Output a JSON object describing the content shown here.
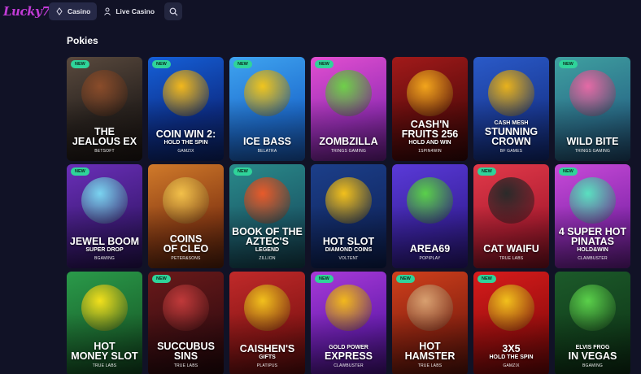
{
  "header": {
    "logo": "Lucky7",
    "nav": [
      {
        "label": "Casino",
        "active": true
      },
      {
        "label": "Live Casino",
        "active": false
      }
    ]
  },
  "section": {
    "title": "Pokies"
  },
  "badge_label": "NEW",
  "games": [
    {
      "title": "THE\nJEALOUS EX",
      "subtitle": "",
      "provider": "BETSOFT",
      "is_new": true
    },
    {
      "title": "COIN WIN 2:",
      "subtitle": "HOLD THE SPIN",
      "provider": "GAMZIX",
      "is_new": true
    },
    {
      "title": "ICE BASS",
      "subtitle": "",
      "provider": "BELATRA",
      "is_new": true
    },
    {
      "title": "ZOMBZILLA",
      "subtitle": "",
      "provider": "TRINGS GAMING",
      "is_new": true
    },
    {
      "title": "CASH'N\nFRUITS 256",
      "subtitle": "HOLD AND WIN",
      "provider": "1SPIN4WIN",
      "is_new": false
    },
    {
      "title": "STUNNING\nCROWN",
      "subtitle": "",
      "provider": "BF GAMES",
      "is_new": false,
      "kicker": "CASH MESH"
    },
    {
      "title": "WILD BITE",
      "subtitle": "",
      "provider": "TRINGS GAMING",
      "is_new": true
    },
    {
      "title": "JEWEL BOOM",
      "subtitle": "SUPER DROP",
      "provider": "BGAMING",
      "is_new": true
    },
    {
      "title": "COINS\nOF CLEO",
      "subtitle": "",
      "provider": "PETER&SONS",
      "is_new": false
    },
    {
      "title": "BOOK OF THE\nAZTEC'S",
      "subtitle": "LEGEND",
      "provider": "ZILLION",
      "is_new": true
    },
    {
      "title": "HOT SLOT",
      "subtitle": "DIAMOND COINS",
      "provider": "VOLTENT",
      "is_new": false
    },
    {
      "title": "AREA69",
      "subtitle": "",
      "provider": "POPIPLAY",
      "is_new": false
    },
    {
      "title": "CAT WAIFU",
      "subtitle": "",
      "provider": "TRUE LABS",
      "is_new": true
    },
    {
      "title": "4 SUPER HOT\nPINATAS",
      "subtitle": "HOLD&WIN",
      "provider": "CLAWBUSTER",
      "is_new": true
    },
    {
      "title": "HOT\nMONEY SLOT",
      "subtitle": "",
      "provider": "TRUE LABS",
      "is_new": false
    },
    {
      "title": "SUCCUBUS\nSINS",
      "subtitle": "",
      "provider": "TRUE LABS",
      "is_new": true
    },
    {
      "title": "CAISHEN'S",
      "subtitle": "GIFTS",
      "provider": "PLATIPUS",
      "is_new": false
    },
    {
      "title": "EXPRESS",
      "subtitle": "",
      "provider": "CLAWBUSTER",
      "is_new": true,
      "kicker": "GOLD POWER"
    },
    {
      "title": "HOT\nHAMSTER",
      "subtitle": "",
      "provider": "TRUE LABS",
      "is_new": true
    },
    {
      "title": "3X5",
      "subtitle": "HOLD THE SPIN",
      "provider": "GAMZIX",
      "is_new": true
    },
    {
      "title": "IN VEGAS",
      "subtitle": "",
      "provider": "BGAMING",
      "is_new": false,
      "kicker": "ELVIS FROG"
    }
  ],
  "art": [
    {
      "bg": "linear-gradient(160deg,#5a4a3e,#2b2420 55%,#1a1310)",
      "motif": "#8a4c2a"
    },
    {
      "bg": "linear-gradient(160deg,#1560d8,#0d2f8a 60%,#0a1f5c)",
      "motif": "#f2b81c"
    },
    {
      "bg": "linear-gradient(160deg,#3fa4f0,#1f6fd0 60%,#164e9e)",
      "motif": "#f0c51e"
    },
    {
      "bg": "linear-gradient(160deg,#e24fd0,#9a2fb8 60%,#5e1a7a)",
      "motif": "#6fd04a"
    },
    {
      "bg": "linear-gradient(160deg,#a21a1a,#5e0c0c 60%,#2e0606)",
      "motif": "#f2a51c"
    },
    {
      "bg": "linear-gradient(160deg,#2a5ac8,#1a3a96 60%,#0f2466)",
      "motif": "#e8b21c"
    },
    {
      "bg": "linear-gradient(160deg,#3fa0a0,#2b6f8a 60%,#1c3f5e)",
      "motif": "#e46aa6"
    },
    {
      "bg": "linear-gradient(160deg,#6a2fb8,#3f1b7a 60%,#22104a)",
      "motif": "#7ad4f0"
    },
    {
      "bg": "linear-gradient(160deg,#d07a2a,#8a3c14 60%,#4a1c0a)",
      "motif": "#f2c04a"
    },
    {
      "bg": "linear-gradient(160deg,#2a8a8a,#1c5c6a 60%,#123844)",
      "motif": "#e85a2a"
    },
    {
      "bg": "linear-gradient(160deg,#1c3f8a,#122a66 60%,#0a1a44)",
      "motif": "#f2c01c"
    },
    {
      "bg": "linear-gradient(160deg,#5a3ad8,#3a22a0 60%,#241466)",
      "motif": "#5ad04a"
    },
    {
      "bg": "linear-gradient(160deg,#e23a4a,#b01e32 60%,#6a0e1c)",
      "motif": "#2a2a2a"
    },
    {
      "bg": "linear-gradient(160deg,#c84ad8,#8a2ab0 60%,#5a1a7a)",
      "motif": "#5ae0c0"
    },
    {
      "bg": "linear-gradient(160deg,#2a9a4a,#1c6a30 60%,#0e3a1a)",
      "motif": "#f2e01c"
    },
    {
      "bg": "linear-gradient(160deg,#6a1a1a,#3e0e12 60%,#1e0608)",
      "motif": "#c03a3a"
    },
    {
      "bg": "linear-gradient(160deg,#c02a2a,#8a1616 60%,#4a0a0a)",
      "motif": "#f2c01c"
    },
    {
      "bg": "linear-gradient(160deg,#a83ad8,#6a1eb0 60%,#3a0e6a)",
      "motif": "#f2b81c"
    },
    {
      "bg": "linear-gradient(160deg,#d0401c,#8a2210 60%,#4a1008)",
      "motif": "#d8a070"
    },
    {
      "bg": "linear-gradient(160deg,#d81c1c,#9a0e0e 60%,#5a0606)",
      "motif": "#f2c01c"
    },
    {
      "bg": "linear-gradient(160deg,#1c5a2a,#12401c 60%,#0a2410)",
      "motif": "#5ad04a"
    }
  ]
}
